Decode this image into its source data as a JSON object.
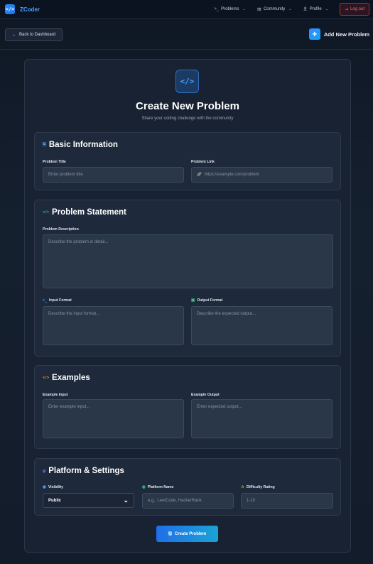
{
  "app": {
    "logo_glyph": "</>",
    "brand": "ZCoder"
  },
  "nav": {
    "items": [
      {
        "icon": ">_",
        "label": "Problems",
        "chevron": "⌄"
      },
      {
        "icon": "👥",
        "label": "Community",
        "chevron": "⌄"
      },
      {
        "icon": "👤",
        "label": "Profile",
        "chevron": "⌄"
      }
    ],
    "logout_icon": "⇥",
    "logout_label": "Log out"
  },
  "subheader": {
    "back_icon": "←",
    "back_label": "Back to Dashboard",
    "add_icon": "+",
    "add_label": "Add New Problem"
  },
  "hero": {
    "icon": "</>",
    "title": "Create New Problem",
    "subtitle": "Share your coding challenge with the community"
  },
  "basic": {
    "icon": "🗎",
    "title": "Basic Information",
    "title_label": "Problem Title",
    "title_placeholder": "Enter problem title",
    "link_label": "Problem Link",
    "link_icon": "🔗",
    "link_placeholder": "https://example.com/problem"
  },
  "statement": {
    "icon": "</>",
    "title": "Problem Statement",
    "desc_label": "Problem Description",
    "desc_placeholder": "Describe the problem in detail...",
    "input_icon": ">_",
    "input_label": "Input Format",
    "input_placeholder": "Describe the input format...",
    "output_icon": "▣",
    "output_label": "Output Format",
    "output_placeholder": "Describe the expected output..."
  },
  "examples": {
    "icon": "</>",
    "title": "Examples",
    "input_label": "Example Input",
    "input_placeholder": "Enter example input...",
    "output_label": "Example Output",
    "output_placeholder": "Enter expected output..."
  },
  "platform": {
    "icon": "◍",
    "title": "Platform & Settings",
    "visibility_icon": "◉",
    "visibility_label": "Visibility",
    "visibility_value": "Public",
    "platform_icon": "◍",
    "platform_label": "Platform Name",
    "platform_placeholder": "e.g., LeetCode, HackerRank",
    "rating_icon": "☆",
    "rating_label": "Difficulty Rating",
    "rating_placeholder": "1-10"
  },
  "submit": {
    "icon": "🖫",
    "label": "Create Problem"
  },
  "colors": {
    "accent": "#2f8cff",
    "logout": "#ff6b6b",
    "statement_icon": "#3ecf8e",
    "examples_icon": "#f0b429",
    "platform_icon": "#a06cff"
  }
}
